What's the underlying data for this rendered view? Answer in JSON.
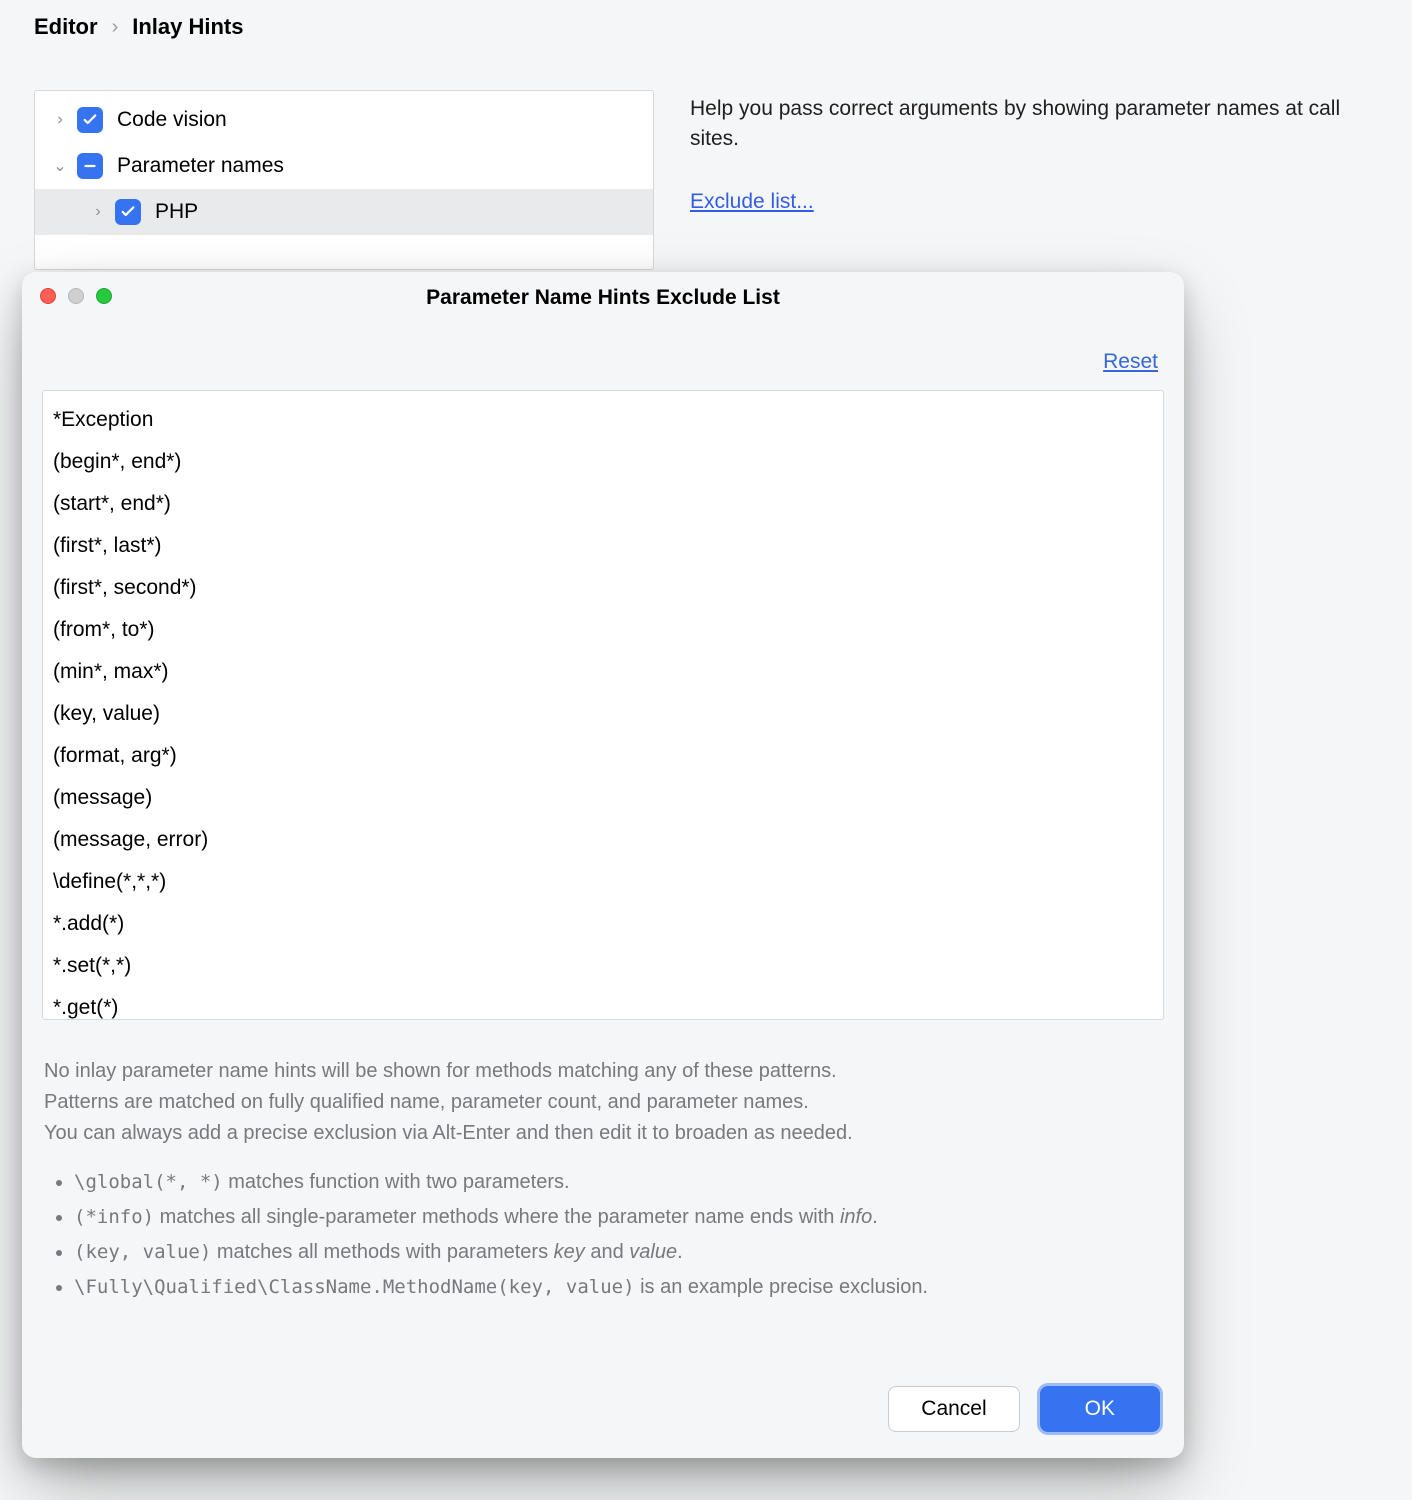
{
  "breadcrumb": {
    "parent": "Editor",
    "current": "Inlay Hints"
  },
  "tree": {
    "items": [
      {
        "label": "Code vision",
        "expand": "›",
        "state": "checked",
        "indent": 0,
        "selected": false
      },
      {
        "label": "Parameter names",
        "expand": "⌄",
        "state": "indeterminate",
        "indent": 0,
        "selected": false
      },
      {
        "label": "PHP",
        "expand": "›",
        "state": "checked",
        "indent": 1,
        "selected": true
      }
    ]
  },
  "help": {
    "text": "Help you pass correct arguments by showing parameter names at call sites.",
    "exclude_link": "Exclude list..."
  },
  "dialog": {
    "title": "Parameter Name Hints Exclude List",
    "reset": "Reset",
    "patterns": [
      "*Exception",
      "(begin*, end*)",
      "(start*, end*)",
      "(first*, last*)",
      "(first*, second*)",
      "(from*, to*)",
      "(min*, max*)",
      "(key, value)",
      "(format, arg*)",
      "(message)",
      "(message, error)",
      "\\define(*,*,*)",
      "*.add(*)",
      "*.set(*,*)",
      "*.get(*)"
    ],
    "hint": {
      "p1": "No inlay parameter name hints will be shown for methods matching any of these patterns.",
      "p2": "Patterns are matched on fully qualified name, parameter count, and parameter names.",
      "p3": "You can always add a precise exclusion via Alt-Enter and then edit it to broaden as needed.",
      "b1_code": "\\global(*, *)",
      "b1_text": " matches function with two parameters.",
      "b2_code": "(*info)",
      "b2_text_a": " matches all single-parameter methods where the parameter name ends with ",
      "b2_em": "info",
      "b2_text_b": ".",
      "b3_code": "(key, value)",
      "b3_text_a": " matches all methods with parameters ",
      "b3_em1": "key",
      "b3_mid": " and ",
      "b3_em2": "value",
      "b3_text_b": ".",
      "b4_code": "\\Fully\\Qualified\\ClassName.MethodName(key, value)",
      "b4_text": " is an example precise exclusion."
    },
    "buttons": {
      "cancel": "Cancel",
      "ok": "OK"
    }
  }
}
